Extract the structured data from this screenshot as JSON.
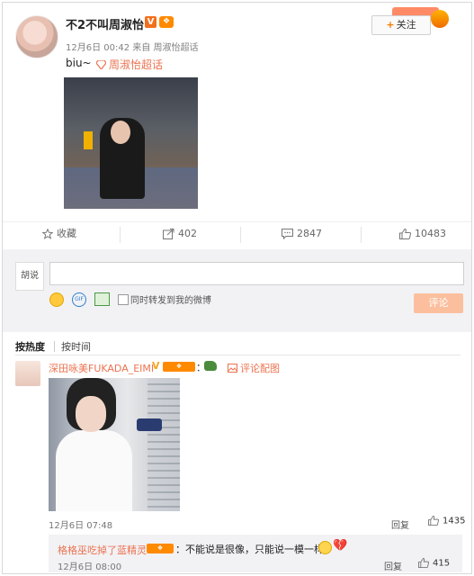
{
  "post": {
    "author_name": "不2不叫周淑怡",
    "verified_badge": "V",
    "timestamp": "12月6日 00:42",
    "source_prefix": "来自",
    "source": "周淑怡超话",
    "follow_label": "关注",
    "text": "biu~",
    "topic_link": "周淑怡超话"
  },
  "actions": {
    "favorite_label": "收藏",
    "repost_count": "402",
    "comment_count": "2847",
    "like_count": "10483"
  },
  "composer": {
    "my_avatar_text": "胡说",
    "input_placeholder": "",
    "repost_checkbox_label": "同时转发到我的微博",
    "submit_label": "评论"
  },
  "sort": {
    "hot_label": "按热度",
    "time_label": "按时间"
  },
  "comments": [
    {
      "author_name": "深田咏美FUKADA_EIMI",
      "verified_badge": "V",
      "colon": "：",
      "picture_link": "评论配图",
      "timestamp": "12月6日 07:48",
      "reply_label": "回复",
      "like_count": "1435",
      "replies": [
        {
          "author_name": "格格巫吃掉了蓝精灵",
          "text": "：不能说是很像，只能说一模一样",
          "heart_glyph": "💔",
          "timestamp": "12月6日 08:00",
          "reply_label": "回复",
          "like_count": "415"
        }
      ]
    }
  ],
  "colors": {
    "accent": "#eb7350",
    "orange_badge": "#ff8a00",
    "submit_disabled": "#fbbf9e",
    "panel_bg": "#f2f2f5"
  }
}
